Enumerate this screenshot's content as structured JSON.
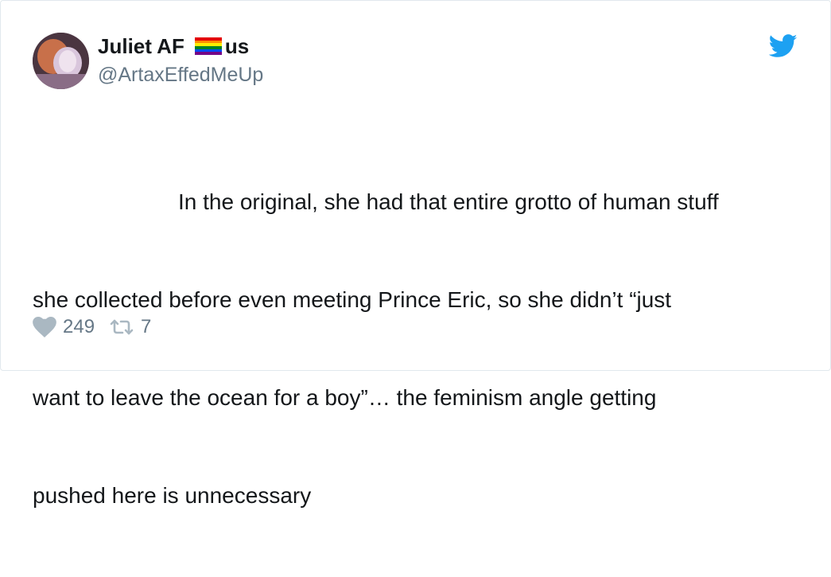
{
  "tweet": {
    "author": {
      "display_name": "Juliet AF",
      "name_suffix": "us",
      "handle": "@ArtaxEffedMeUp",
      "avatar": "avatar-photo",
      "badge_icon": "rainbow-flag-icon"
    },
    "text_lines": [
      "In the original, she had that entire grotto of human stuff",
      "she collected before even meeting Prince Eric, so she didn’t “just",
      "want to leave the ocean for a boy”… the feminism angle getting",
      "pushed here is unnecessary"
    ],
    "actions": {
      "like_icon": "heart-icon",
      "like_count": "249",
      "retweet_icon": "retweet-icon",
      "retweet_count": "7"
    },
    "brand_icon": "twitter-bird-icon"
  },
  "colors": {
    "brand": "#1da1f2",
    "text": "#14171a",
    "secondary": "#657786",
    "border": "#e1e8ed",
    "flag": [
      "#e40303",
      "#ff8c00",
      "#ffed00",
      "#008026",
      "#004dff",
      "#750787"
    ]
  }
}
